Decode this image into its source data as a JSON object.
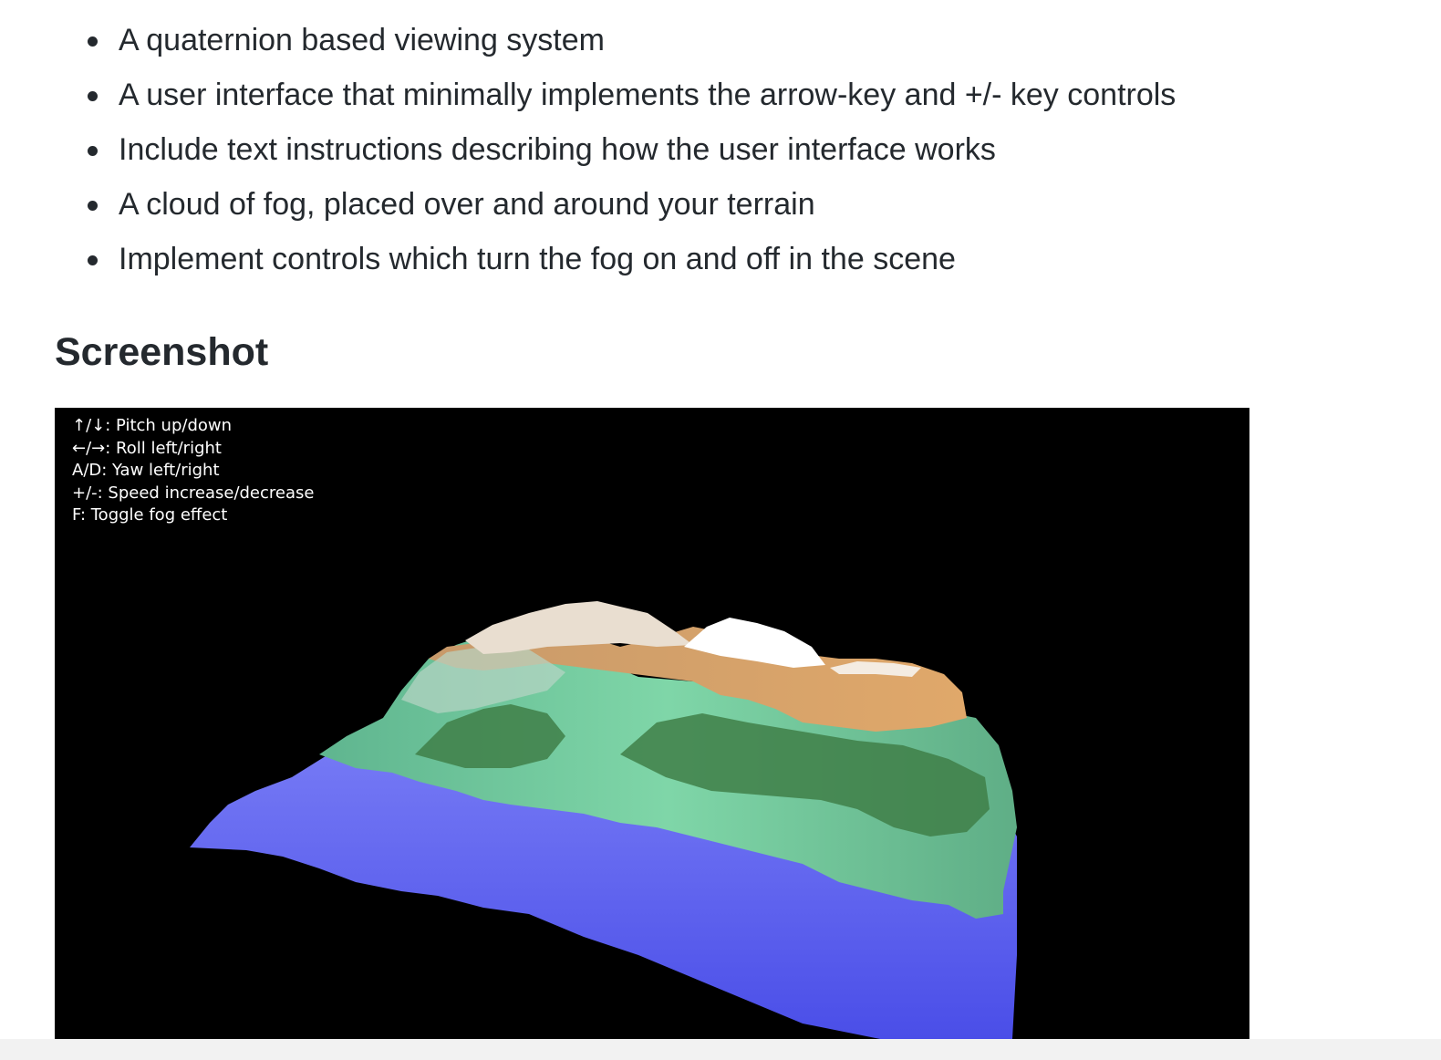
{
  "requirements": {
    "items": [
      "A quaternion based viewing system",
      "A user interface that minimally implements the arrow-key and +/- key controls",
      "Include text instructions describing how the user interface works",
      "A cloud of fog, placed over and around your terrain",
      "Implement controls which turn the fog on and off in the scene"
    ]
  },
  "heading": "Screenshot",
  "screenshot": {
    "instructions": [
      "↑/↓: Pitch up/down",
      "←/→: Roll left/right",
      "A/D: Yaw left/right",
      "+/-: Speed increase/decrease",
      "F: Toggle fog effect"
    ],
    "colors": {
      "background": "#000000",
      "water": "#5a5ef0",
      "grass": "#6ec79a",
      "forest": "#3f7f48",
      "rock": "#d6a26a",
      "snow": "#ffffff"
    }
  }
}
